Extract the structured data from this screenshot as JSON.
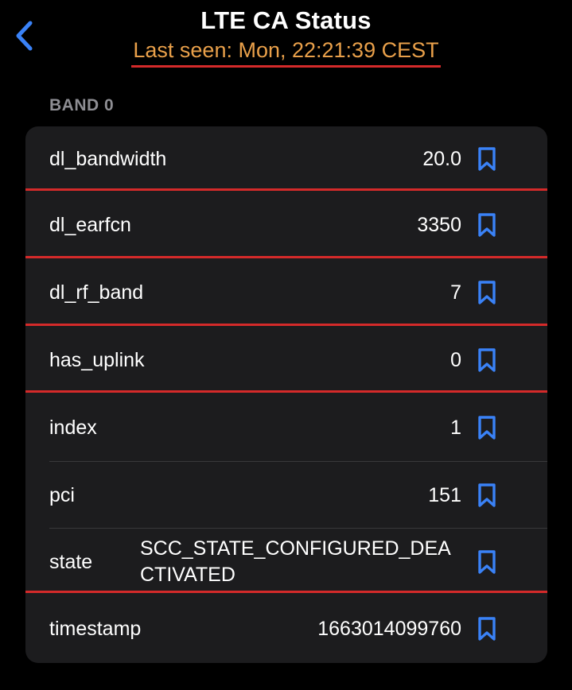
{
  "header": {
    "back_icon": "chevron-left-icon",
    "title": "LTE CA Status",
    "subtitle": "Last seen: Mon, 22:21:39 CEST"
  },
  "section": {
    "title": "BAND 0"
  },
  "rows": [
    {
      "label": "dl_bandwidth",
      "value": "20.0"
    },
    {
      "label": "dl_earfcn",
      "value": "3350"
    },
    {
      "label": "dl_rf_band",
      "value": "7"
    },
    {
      "label": "has_uplink",
      "value": "0"
    },
    {
      "label": "index",
      "value": "1"
    },
    {
      "label": "pci",
      "value": "151"
    },
    {
      "label": "state",
      "value": "SCC_STATE_CONFIGURED_DEACTIVATED"
    },
    {
      "label": "timestamp",
      "value": "1663014099760"
    }
  ],
  "colors": {
    "accent": "#3a82f7",
    "subtitle": "#e9a04a",
    "annotation_underline": "#d42a2a",
    "card_background": "#1c1c1e",
    "background": "#000000"
  }
}
